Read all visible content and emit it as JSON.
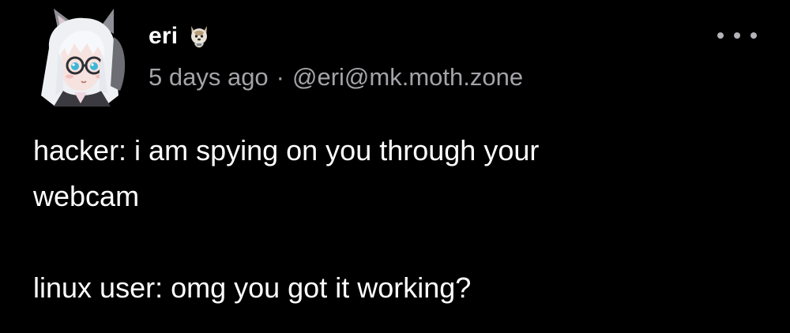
{
  "post": {
    "author": {
      "display_name": "eri",
      "badge_icon": "dog-emoji-icon",
      "avatar_icon": "anime-avatar-icon"
    },
    "meta": {
      "time_ago": "5 days ago",
      "separator": "·",
      "handle": "@eri@mk.moth.zone"
    },
    "more_icon": "ellipsis-icon",
    "body": {
      "line1": "hacker: i am spying on you through your\nwebcam",
      "line2": "linux user: omg you got it working?"
    }
  },
  "colors": {
    "background": "#000000",
    "text": "#ffffff",
    "muted": "#a3a3a8"
  }
}
